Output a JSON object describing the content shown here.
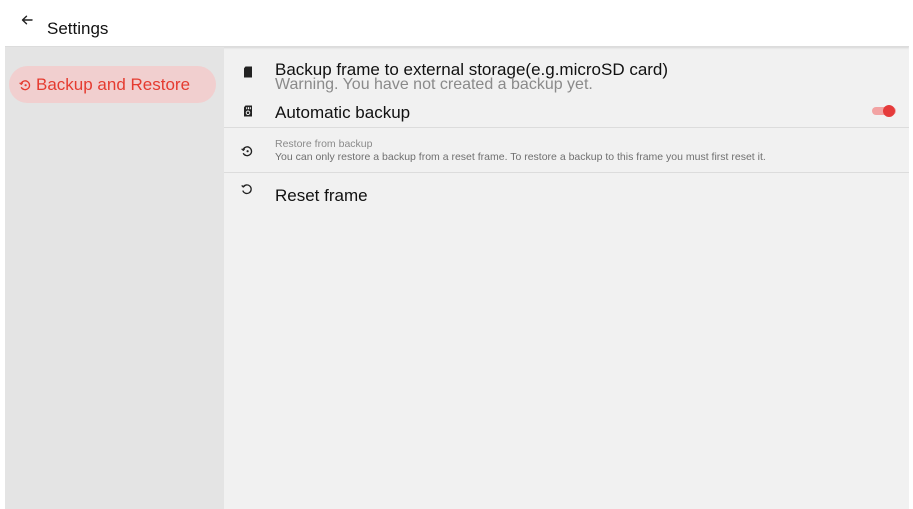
{
  "header": {
    "back_icon": "arrow-left-icon",
    "title": "Settings"
  },
  "sidebar": {
    "items": [
      {
        "label": "Backup and Restore",
        "icon": "restore-icon",
        "selected": true
      }
    ]
  },
  "settings": {
    "backup_external": {
      "title": "Backup frame to external storage(e.g.microSD card)",
      "subtitle": "Warning. You have not created a backup yet.",
      "icon": "sd-card-icon"
    },
    "automatic_backup": {
      "title": "Automatic backup",
      "icon": "sd-card-backup-icon",
      "toggle_on": true
    },
    "restore": {
      "title": "Restore from backup",
      "subtitle": "You can only restore a backup from a reset frame. To restore a backup to this frame you must first reset it.",
      "icon": "restore-icon"
    },
    "reset": {
      "title": "Reset frame",
      "icon": "reset-icon"
    }
  },
  "colors": {
    "accent": "#e53b30",
    "selected_bg": "#f1cfcf",
    "toggle_track": "#f2a3a3",
    "toggle_knob": "#e53b3b"
  }
}
